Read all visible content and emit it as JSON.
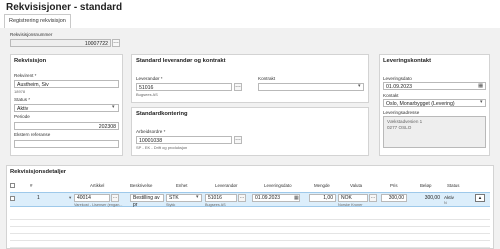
{
  "page": {
    "title": "Rekvisisjoner - standard"
  },
  "tabs": [
    {
      "label": "Registrering rekvisisjon"
    }
  ],
  "header": {
    "req_number_label": "Rekvisisjonsnummer",
    "req_number_value": "10007722"
  },
  "rekvisisjon": {
    "title": "Rekvisisjon",
    "rekvirent_label": "Rekvirent *",
    "rekvirent_value": "Austheim, Siv",
    "rekvirent_sub": "18978",
    "status_label": "Status *",
    "status_value": "Aktiv",
    "periode_label": "Periode",
    "periode_value": "202308",
    "ekstern_label": "Ekstern referanse",
    "ekstern_value": ""
  },
  "leverandor": {
    "title": "Standard leverandør og kontrakt",
    "leverandor_label": "Leverandør *",
    "leverandor_value": "51016",
    "leverandor_sub": "Bugsees AS",
    "kontrakt_label": "Kontrakt",
    "kontrakt_value": ""
  },
  "kontering": {
    "title": "Standardkontering",
    "arbeidsordre_label": "Arbeidsordre *",
    "arbeidsordre_value": "10001038",
    "arbeidsordre_sub": "SP - EK - Drift og produksjon"
  },
  "leveringskontakt": {
    "title": "Leveringskontakt",
    "dato_label": "Leveringsdato",
    "dato_value": "01.09.2023",
    "kontakt_label": "Kontakt",
    "kontakt_value": "Oslo, Monarbygget (Levering)",
    "adresse_label": "Leveringsadresse",
    "adresse_line1": "Vækstadvesien 1",
    "adresse_line2": "0277 OSLO"
  },
  "details": {
    "title": "Rekvisisjonsdetaljer",
    "columns": [
      "#",
      "Artikkel",
      "Beskrivelse",
      "Enhet",
      "Leverandør",
      "Leveringsdato",
      "Mengde",
      "Valuta",
      "Pris",
      "Beløp",
      "Status"
    ],
    "row": {
      "num": "1",
      "artikkel": "40014",
      "artikkel_sub": "Varekost - Lisenser (engan...",
      "beskrivelse": "Bestilling av pr",
      "enhet": "STK",
      "enhet_sub": "Stykk",
      "leverandor": "51016",
      "leverandor_sub": "Bugsees AS",
      "leveringsdato": "01.09.2023",
      "mengde": "1,00",
      "valuta": "NOK",
      "valuta_sub": "Norske Kroner",
      "pris": "300,00",
      "belop": "300,00",
      "status": "Aktiv",
      "status_sub": "N"
    }
  }
}
